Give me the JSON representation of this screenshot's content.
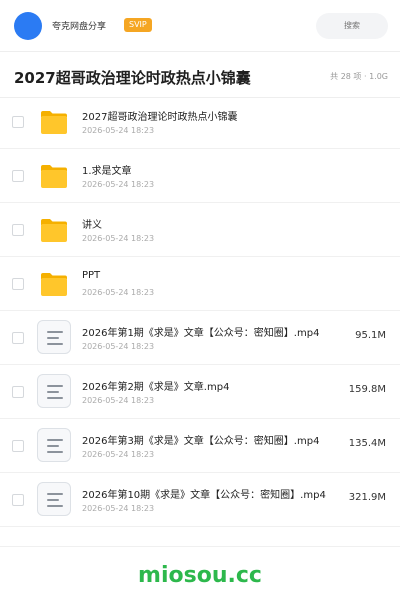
{
  "header": {
    "brand": "夸克网盘分享",
    "badge": "SVIP",
    "search_placeholder": "搜索",
    "accent": "#2b7bf3",
    "badge_color": "#f5a623"
  },
  "share": {
    "title": "2027超哥政治理论时政热点小锦囊",
    "meta": "共 28 项 · 1.0G"
  },
  "items": [
    {
      "type": "folder",
      "icon": "folder-icon",
      "name": "2027超哥政治理论时政热点小锦囊",
      "date": "2026-05-24 18:23",
      "size": ""
    },
    {
      "type": "folder",
      "icon": "folder-icon",
      "name": "1.求是文章",
      "date": "2026-05-24 18:23",
      "size": ""
    },
    {
      "type": "folder",
      "icon": "folder-icon",
      "name": "讲义",
      "date": "2026-05-24 18:23",
      "size": ""
    },
    {
      "type": "folder",
      "icon": "folder-icon",
      "name": "PPT",
      "date": "2026-05-24 18:23",
      "size": ""
    },
    {
      "type": "file",
      "icon": "document-icon",
      "name": "2026年第1期《求是》文章【公众号：密知圈】.mp4",
      "date": "2026-05-24 18:23",
      "size": "95.1M"
    },
    {
      "type": "file",
      "icon": "document-icon",
      "name": "2026年第2期《求是》文章.mp4",
      "date": "2026-05-24 18:23",
      "size": "159.8M"
    },
    {
      "type": "file",
      "icon": "document-icon",
      "name": "2026年第3期《求是》文章【公众号：密知圈】.mp4",
      "date": "2026-05-24 18:23",
      "size": "135.4M"
    },
    {
      "type": "file",
      "icon": "document-icon",
      "name": "2026年第10期《求是》文章【公众号：密知圈】.mp4",
      "date": "2026-05-24 18:23",
      "size": "321.9M"
    }
  ],
  "footer": {
    "watermark": "miosou.cc",
    "watermark_color": "#2db84c"
  }
}
